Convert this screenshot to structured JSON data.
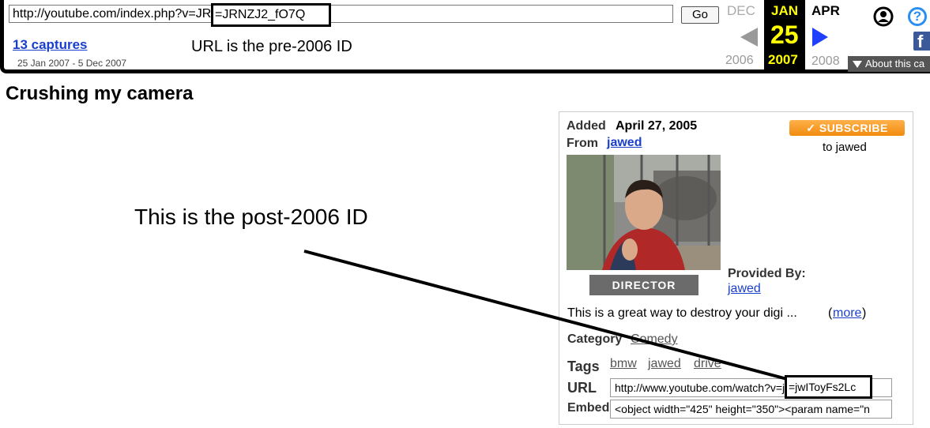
{
  "wayback": {
    "url_value": "http://youtube.com/index.php?v=JRNZJ2_fO7Q",
    "go_label": "Go",
    "captures_link": "13 captures",
    "captures_range": "25 Jan 2007 - 5 Dec 2007",
    "prev_month": "DEC",
    "current_month": "JAN",
    "next_month": "APR",
    "current_day": "25",
    "prev_year": "2006",
    "current_year": "2007",
    "next_year": "2008",
    "about_label": "About this ca",
    "facebook_glyph": "f",
    "help_glyph": "?"
  },
  "annotations": {
    "url_highlight": "=JRNZJ2_fO7Q",
    "url_note": "URL is the pre-2006 ID",
    "post_note": "This is the post-2006 ID",
    "id_highlight": "=jwIToyFs2Lc"
  },
  "video": {
    "title": "Crushing my camera",
    "added_label": "Added",
    "added_date": "April 27, 2005",
    "from_label": "From",
    "author": "jawed",
    "subscribe_label": "✓ SUBSCRIBE",
    "subscribe_sub": "to jawed",
    "director_badge": "DIRECTOR",
    "provided_by_label": "Provided By:",
    "provided_by": "jawed",
    "description": "This is a great way to destroy your digi ...",
    "more_open": "(",
    "more_link": "more",
    "more_close": ")",
    "category_label": "Category",
    "category": "Comedy",
    "tags_label": "Tags",
    "tags": [
      "bmw",
      "jawed",
      "drive"
    ],
    "url_label": "URL",
    "url_value": "http://www.youtube.com/watch?v=jwIToyFs2Lc",
    "embed_label": "Embed",
    "embed_value": "<object width=\"425\" height=\"350\"><param name=\"n"
  },
  "colors": {
    "link": "#1a3fcb",
    "highlight_year": "#ffff00",
    "subscribe": "#f39a1f",
    "next_arrow": "#2040ff"
  },
  "icons": [
    "prev-arrow-icon",
    "next-arrow-icon",
    "user-icon",
    "help-icon",
    "facebook-icon",
    "caret-down-icon"
  ]
}
